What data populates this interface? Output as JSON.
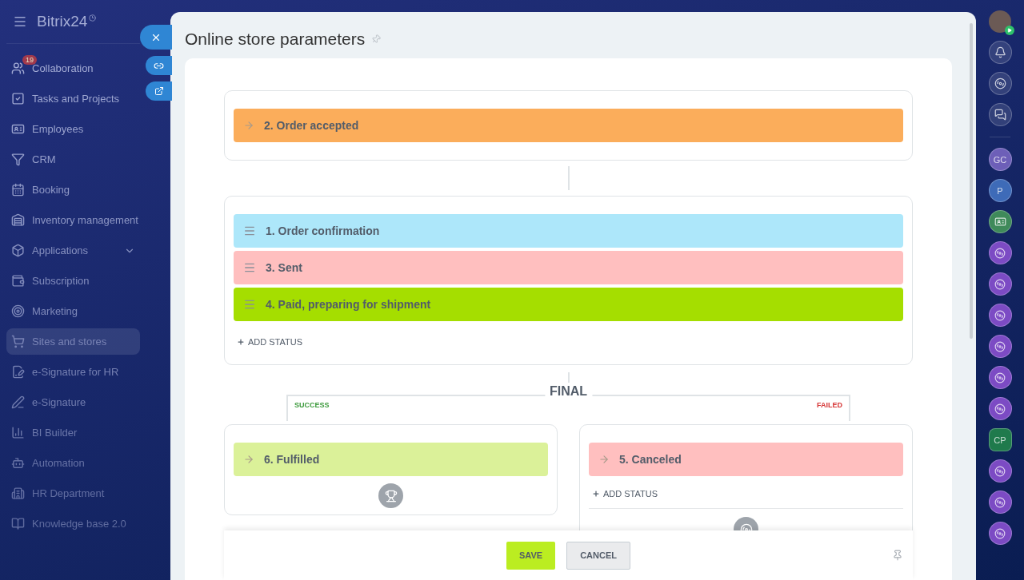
{
  "sidebar": {
    "logo": "Bitrix24",
    "items": [
      {
        "label": "Collaboration",
        "kind": "collab",
        "badge": "19",
        "selected": false
      },
      {
        "label": "Tasks and Projects",
        "kind": "tasks",
        "selected": false
      },
      {
        "label": "Employees",
        "kind": "employees",
        "selected": false
      },
      {
        "label": "CRM",
        "kind": "crm",
        "selected": false
      },
      {
        "label": "Booking",
        "kind": "booking",
        "selected": false
      },
      {
        "label": "Inventory management",
        "kind": "inventory",
        "selected": false
      },
      {
        "label": "Applications",
        "kind": "apps",
        "expanded": false,
        "selected": false
      },
      {
        "label": "Subscription",
        "kind": "subscription",
        "selected": false
      },
      {
        "label": "Marketing",
        "kind": "marketing",
        "selected": false
      },
      {
        "label": "Sites and stores",
        "kind": "sites",
        "selected": true
      },
      {
        "label": "e-Signature for HR",
        "kind": "esignhr",
        "selected": false
      },
      {
        "label": "e-Signature",
        "kind": "esign",
        "selected": false
      },
      {
        "label": "BI Builder",
        "kind": "bi",
        "selected": false
      },
      {
        "label": "Automation",
        "kind": "automation",
        "selected": false
      },
      {
        "label": "HR Department",
        "kind": "hr",
        "selected": false
      },
      {
        "label": "Knowledge base 2.0",
        "kind": "kb",
        "selected": false
      }
    ]
  },
  "panel": {
    "title": "Online store parameters",
    "initial_group": [
      {
        "label": "2. Order accepted",
        "kind": "fixed",
        "color": "#fbad5b"
      }
    ],
    "working_group": {
      "items": [
        {
          "label": "1. Order confirmation",
          "kind": "movable",
          "color": "#ade7fa"
        },
        {
          "label": "3. Sent",
          "kind": "movable",
          "color": "#ffbfbf"
        },
        {
          "label": "4. Paid, preparing for shipment",
          "kind": "movable",
          "color": "#a5de00"
        }
      ],
      "add_status": "ADD STATUS"
    },
    "final": {
      "title": "FINAL",
      "success_label": "SUCCESS",
      "failed_label": "FAILED",
      "success": [
        {
          "label": "6. Fulfilled",
          "kind": "fixed",
          "color": "#dbf199"
        }
      ],
      "failed": [
        {
          "label": "5. Canceled",
          "kind": "fixed",
          "color": "#ffbfbf"
        }
      ],
      "failed_add_status": "ADD STATUS"
    },
    "buttons": {
      "save": "SAVE",
      "cancel": "CANCEL"
    }
  },
  "right_bar": {
    "items": [
      {
        "kind": "bell"
      },
      {
        "kind": "spiral"
      },
      {
        "kind": "chat"
      },
      {
        "kind": "initials",
        "text": "GC",
        "color": "#6d5fb8"
      },
      {
        "kind": "initials",
        "text": "P",
        "color": "#3e6bb8"
      },
      {
        "kind": "card",
        "color": "#3f8a5a"
      },
      {
        "kind": "group",
        "color": "#7c4bc4"
      },
      {
        "kind": "group",
        "color": "#7c4bc4"
      },
      {
        "kind": "group",
        "color": "#7c4bc4"
      },
      {
        "kind": "group",
        "color": "#7c4bc4"
      },
      {
        "kind": "group",
        "color": "#7c4bc4"
      },
      {
        "kind": "group",
        "color": "#7c4bc4"
      },
      {
        "kind": "hex",
        "text": "CP",
        "color": "#1f7a4c"
      },
      {
        "kind": "group",
        "color": "#7c4bc4"
      },
      {
        "kind": "group",
        "color": "#7c4bc4"
      },
      {
        "kind": "group",
        "color": "#7c4bc4"
      }
    ]
  }
}
